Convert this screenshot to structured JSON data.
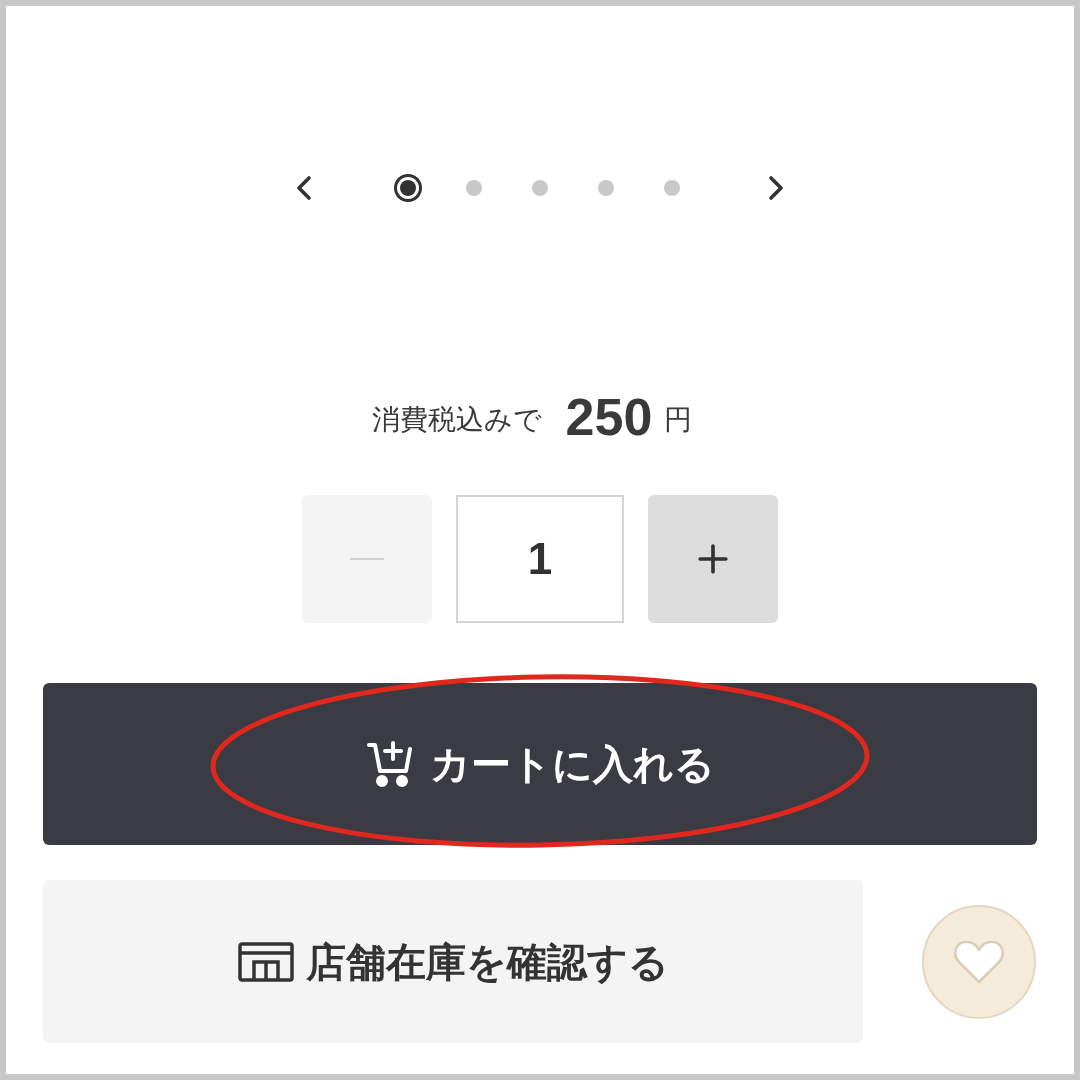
{
  "carousel": {
    "dots": [
      {
        "selected": true
      },
      {
        "selected": false
      },
      {
        "selected": false
      },
      {
        "selected": false
      },
      {
        "selected": false
      }
    ]
  },
  "price": {
    "label": "消費税込みで",
    "amount": "250",
    "unit": "円"
  },
  "quantity": {
    "value": "1",
    "decrement": {
      "disabled": true
    },
    "increment": {
      "disabled": false
    }
  },
  "cart_button": {
    "label": "カートに入れる"
  },
  "store_button": {
    "label": "店舗在庫を確認する"
  }
}
